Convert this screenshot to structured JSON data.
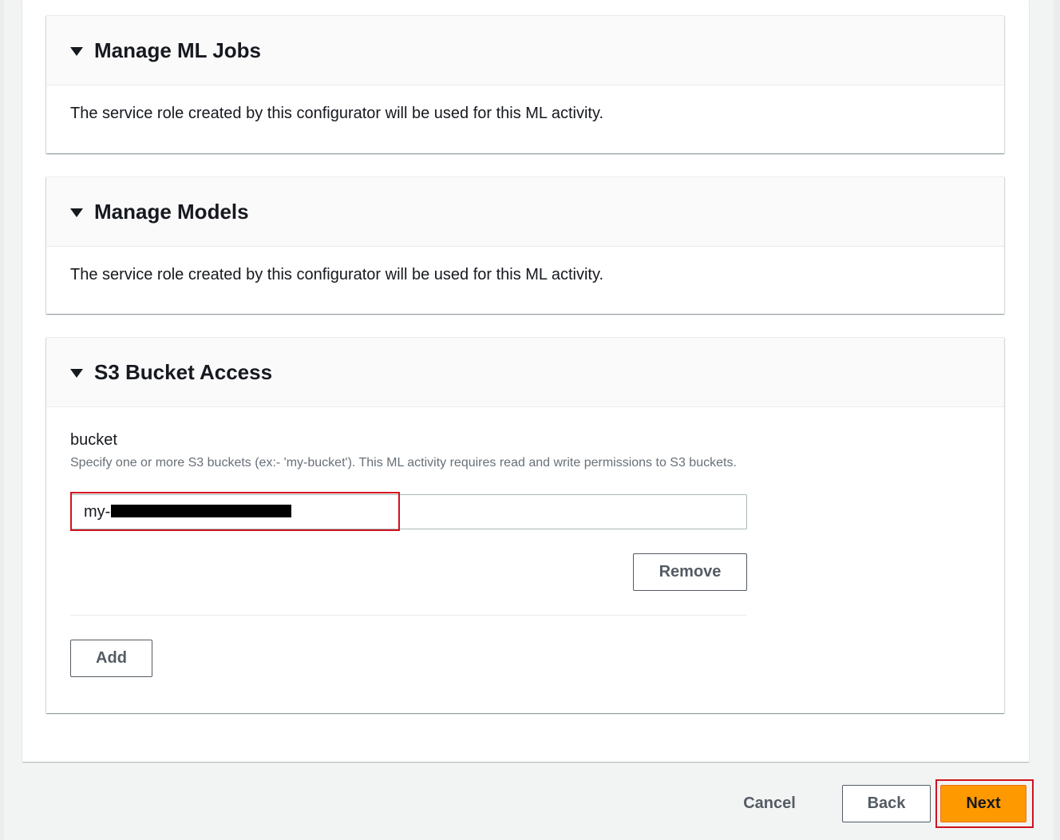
{
  "sections": [
    {
      "title": "Manage ML Jobs",
      "body": "The service role created by this configurator will be used for this ML activity."
    },
    {
      "title": "Manage Models",
      "body": "The service role created by this configurator will be used for this ML activity."
    },
    {
      "title": "S3 Bucket Access"
    }
  ],
  "bucket": {
    "label": "bucket",
    "description": "Specify one or more S3 buckets (ex:- 'my-bucket'). This ML activity requires read and write permissions to S3 buckets.",
    "value": "my-",
    "remove_label": "Remove",
    "add_label": "Add"
  },
  "footer": {
    "cancel_label": "Cancel",
    "back_label": "Back",
    "next_label": "Next"
  },
  "colors": {
    "primary": "#ff9900",
    "highlight": "#d0121f"
  }
}
